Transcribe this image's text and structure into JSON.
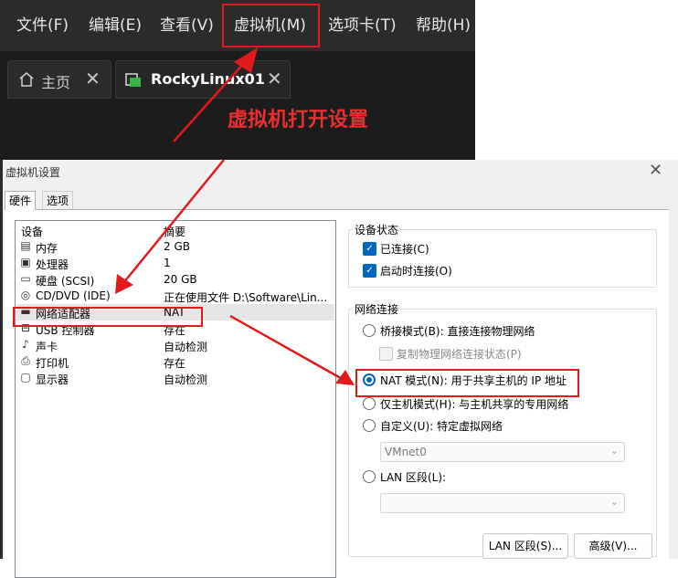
{
  "menubar": {
    "items": [
      "文件(F)",
      "编辑(E)",
      "查看(V)",
      "虚拟机(M)",
      "选项卡(T)",
      "帮助(H)"
    ]
  },
  "tabs": {
    "home": "主页",
    "vm": "RockyLinux01"
  },
  "annotation": {
    "text": "虚拟机打开设置"
  },
  "dialog": {
    "title": "虚拟机设置",
    "tabs": [
      "硬件",
      "选项"
    ],
    "columns": {
      "device": "设备",
      "summary": "摘要"
    },
    "devices": [
      {
        "icon": "memory-icon",
        "name": "内存",
        "summary": "2 GB"
      },
      {
        "icon": "processor-icon",
        "name": "处理器",
        "summary": "1"
      },
      {
        "icon": "harddisk-icon",
        "name": "硬盘 (SCSI)",
        "summary": "20 GB"
      },
      {
        "icon": "cdrom-icon",
        "name": "CD/DVD (IDE)",
        "summary": "正在使用文件 D:\\Software\\Lin..."
      },
      {
        "icon": "network-icon",
        "name": "网络适配器",
        "summary": "NAT"
      },
      {
        "icon": "usb-icon",
        "name": "USB 控制器",
        "summary": "存在"
      },
      {
        "icon": "sound-icon",
        "name": "声卡",
        "summary": "自动检测"
      },
      {
        "icon": "printer-icon",
        "name": "打印机",
        "summary": "存在"
      },
      {
        "icon": "display-icon",
        "name": "显示器",
        "summary": "自动检测"
      }
    ],
    "device_status": {
      "title": "设备状态",
      "connected": "已连接(C)",
      "connect_on_start": "启动时连接(O)"
    },
    "network": {
      "title": "网络连接",
      "bridged": "桥接模式(B): 直接连接物理网络",
      "replicate": "复制物理网络连接状态(P)",
      "nat": "NAT 模式(N): 用于共享主机的 IP 地址",
      "host_only": "仅主机模式(H): 与主机共享的专用网络",
      "custom": "自定义(U): 特定虚拟网络",
      "custom_value": "VMnet0",
      "lan": "LAN 区段(L):",
      "lan_value": ""
    },
    "buttons": {
      "lan_segments": "LAN 区段(S)...",
      "advanced": "高级(V)..."
    }
  },
  "colors": {
    "highlight": "#e3191c",
    "accent": "#0067c0"
  }
}
